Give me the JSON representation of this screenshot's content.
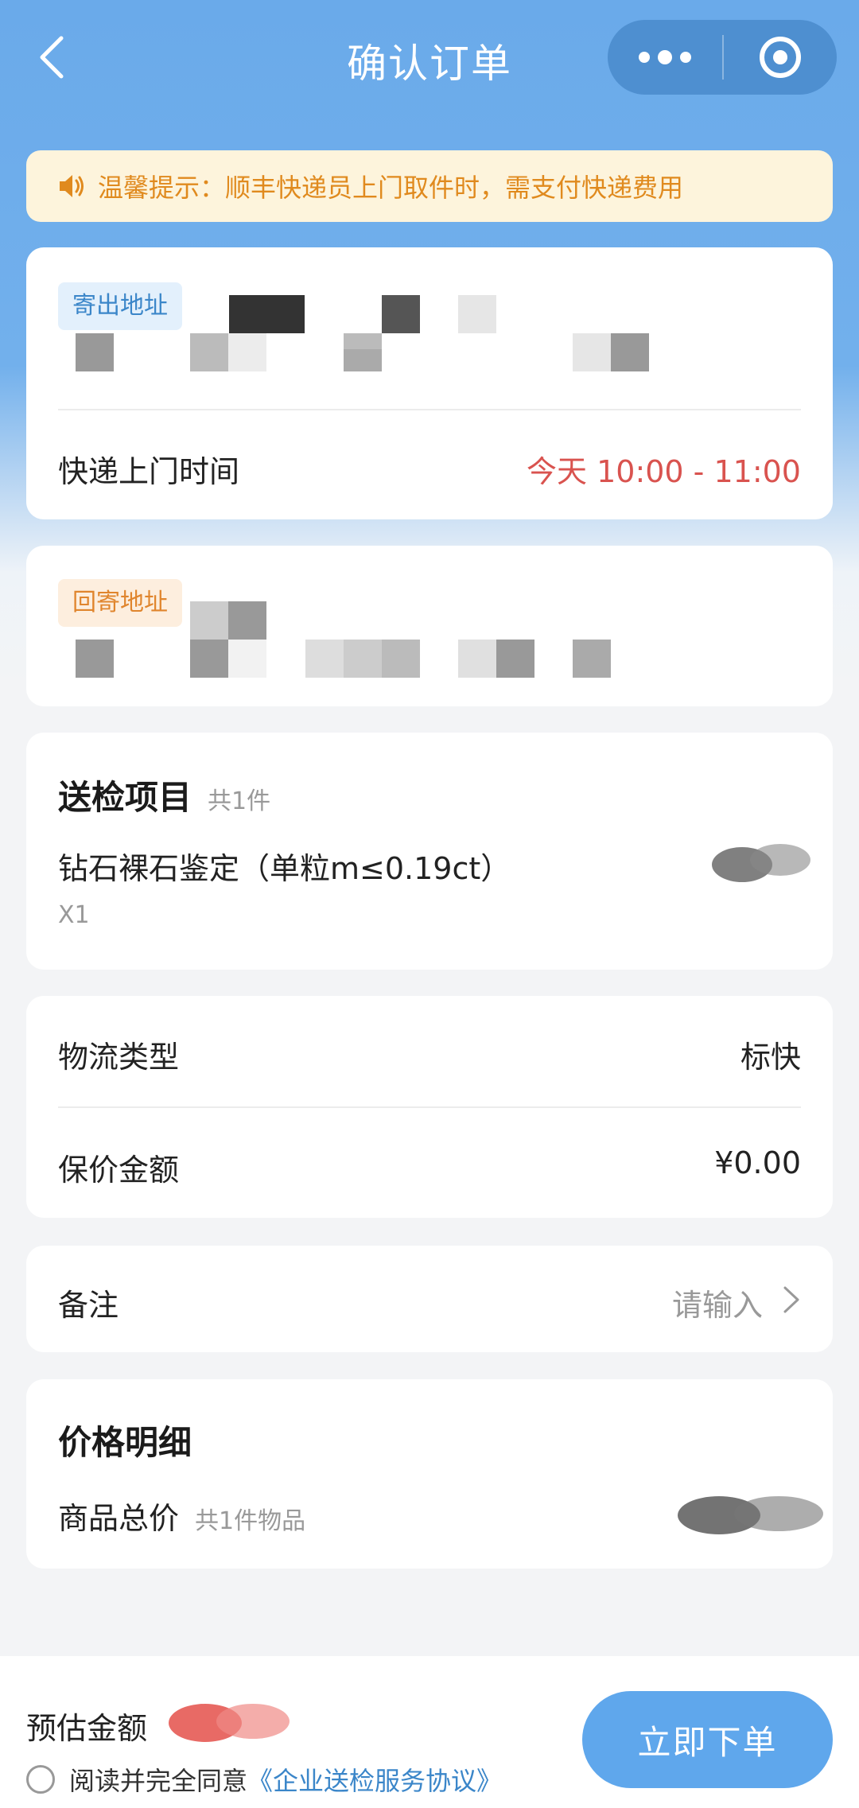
{
  "nav": {
    "title": "确认订单",
    "back_icon": "chevron-left-icon",
    "more_icon": "more-dots-icon",
    "close_icon": "target-circle-icon"
  },
  "notice": {
    "icon": "speaker-icon",
    "text": "温馨提示：顺丰快递员上门取件时，需支付快递费用"
  },
  "send_address": {
    "tag": "寄出地址",
    "pickup_label": "快递上门时间",
    "pickup_value": "今天 10:00 - 11:00"
  },
  "return_address": {
    "tag": "回寄地址"
  },
  "inspection": {
    "title": "送检项目",
    "count": "共1件",
    "item_name": "钻石裸石鉴定（单粒m≤0.19ct）",
    "item_qty": "X1"
  },
  "logistics": {
    "type_label": "物流类型",
    "type_value": "标快",
    "insured_label": "保价金额",
    "insured_value": "¥0.00"
  },
  "remark": {
    "label": "备注",
    "placeholder": "请输入"
  },
  "price": {
    "title": "价格明细",
    "total_label": "商品总价",
    "total_sub": "共1件物品"
  },
  "bottom": {
    "estimate_label": "预估金额",
    "agree_text": "阅读并完全同意",
    "agree_link": "《企业送检服务协议》",
    "submit_label": "立即下单"
  },
  "colors": {
    "primary": "#5fa7ec",
    "header_bg": "#6aaaea",
    "notice_text": "#e08a1e",
    "pickup_time": "#d9534f"
  }
}
